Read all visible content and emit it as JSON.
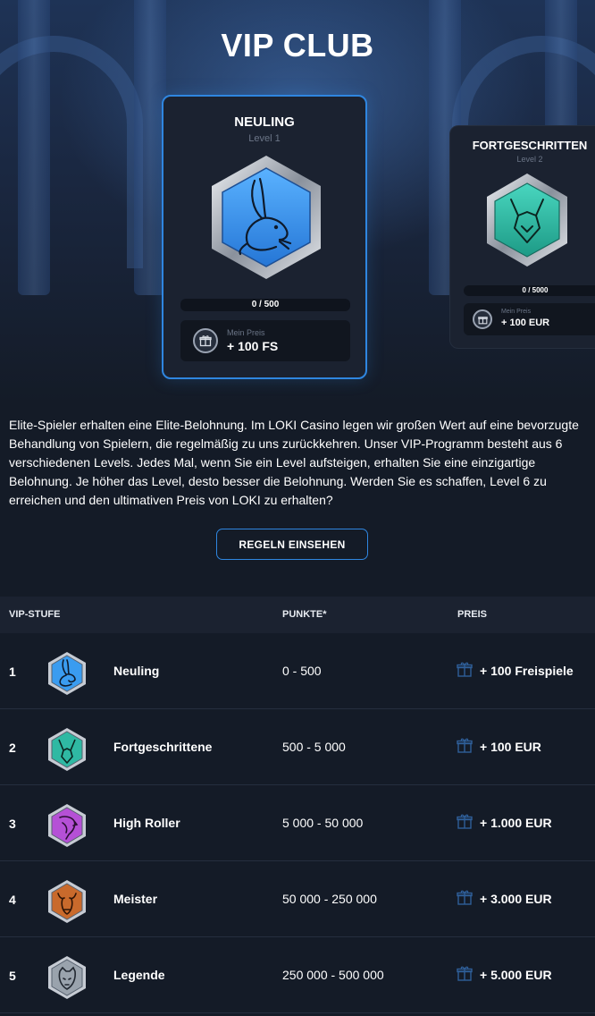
{
  "page": {
    "title": "VIP CLUB"
  },
  "cards": [
    {
      "name": "NEULING",
      "level": "Level 1",
      "progress": "0 / 500",
      "prize_label": "Mein Preis",
      "prize": "+ 100 FS",
      "color": "#3a9cf0"
    },
    {
      "name": "FORTGESCHRITTEN",
      "level": "Level 2",
      "progress": "0 / 5000",
      "prize_label": "Mein Preis",
      "prize": "+ 100 EUR",
      "color": "#2fb9a3"
    }
  ],
  "description": "Elite-Spieler erhalten eine Elite-Belohnung. Im LOKI Casino legen wir großen Wert auf eine bevorzugte Behandlung von Spielern, die regelmäßig zu uns zurückkehren. Unser VIP-Programm besteht aus 6 verschiedenen Levels. Jedes Mal, wenn Sie ein Level aufsteigen, erhalten Sie eine einzigartige Belohnung. Je höher das Level, desto besser die Belohnung. Werden Sie es schaffen, Level 6 zu erreichen und den ultimativen Preis von LOKI zu erhalten?",
  "rules_button": "REGELN EINSEHEN",
  "table": {
    "headers": {
      "level": "VIP-STUFE",
      "points": "PUNKTE*",
      "prize": "PREIS"
    },
    "rows": [
      {
        "num": "1",
        "name": "Neuling",
        "points": "0 - 500",
        "prize": "+ 100 Freispiele",
        "color": "#3a9cf0",
        "icon": "rabbit-icon"
      },
      {
        "num": "2",
        "name": "Fortgeschrittene",
        "points": "500 - 5 000",
        "prize": "+ 100 EUR",
        "color": "#2fb9a3",
        "icon": "fox-icon"
      },
      {
        "num": "3",
        "name": "High Roller",
        "points": "5 000 - 50 000",
        "prize": "+ 1.000 EUR",
        "color": "#b550d6",
        "icon": "eagle-icon"
      },
      {
        "num": "4",
        "name": "Meister",
        "points": "50 000 - 250 000",
        "prize": "+ 3.000 EUR",
        "color": "#c96a2c",
        "icon": "bull-icon"
      },
      {
        "num": "5",
        "name": "Legende",
        "points": "250 000 - 500 000",
        "prize": "+ 5.000 EUR",
        "color": "#9aa3ad",
        "icon": "tiger-icon"
      }
    ]
  },
  "colors": {
    "accent": "#2f86e0",
    "background": "#141b27",
    "panel": "#1b2230"
  }
}
